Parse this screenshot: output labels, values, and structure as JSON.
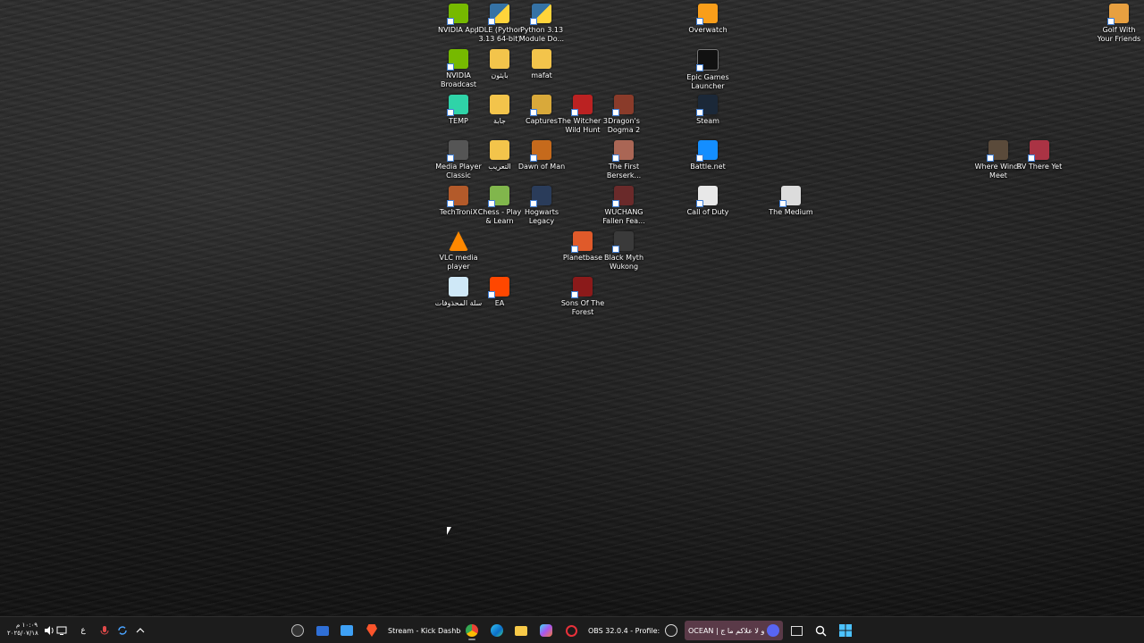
{
  "desktop": {
    "icons": {
      "nvidia_app": "NVIDIA App",
      "idle": "IDLE (Python 3.13 64-bit)",
      "python_module_docs": "Python 3.13 Module Do...",
      "overwatch": "Overwatch",
      "golf": "Golf With Your Friends",
      "nvidia_broadcast": "NVIDIA Broadcast",
      "folder_arabic_1": "بايثون",
      "mafat": "mafat",
      "epic": "Epic Games Launcher",
      "temp": "TEMP",
      "folder_arabic_2": "جابة",
      "captures": "Captures",
      "witcher": "The Witcher 3 Wild Hunt",
      "dragons_dogma": "Dragon's Dogma 2",
      "steam": "Steam",
      "mpc": "Media Player Classic",
      "folder_arabic_3": "التعريب",
      "dawn_of_man": "Dawn of Man",
      "first_berserker": "The First Berserk...",
      "battlenet": "Battle.net",
      "where_winds_meet": "Where Winds Meet",
      "rv_there_yet": "RV There Yet",
      "techtronix": "TechTroniX",
      "chess": "Chess - Play & Learn",
      "hogwarts": "Hogwarts Legacy",
      "wuchang": "WUCHANG Fallen Fea...",
      "call_of_duty": "Call of Duty",
      "the_medium": "The Medium",
      "vlc": "VLC media player",
      "planetbase": "Planetbase",
      "black_myth": "Black Myth Wukong",
      "recycle_bin": "سلة المحذوفات",
      "ea": "EA",
      "sons_of_forest": "Sons Of The Forest"
    }
  },
  "taskbar": {
    "clock_time": "١٠:٠٩ م",
    "clock_date": "٢٠٢٥/٠٧/١٨",
    "language": "ع",
    "apps": {
      "brave_title": "Stream - Kick Dashboard",
      "obs_title": "OBS 32.0.4 - Profile: بدون",
      "discord_title": "OCEAN | او لا علاكم ما ج..."
    }
  }
}
